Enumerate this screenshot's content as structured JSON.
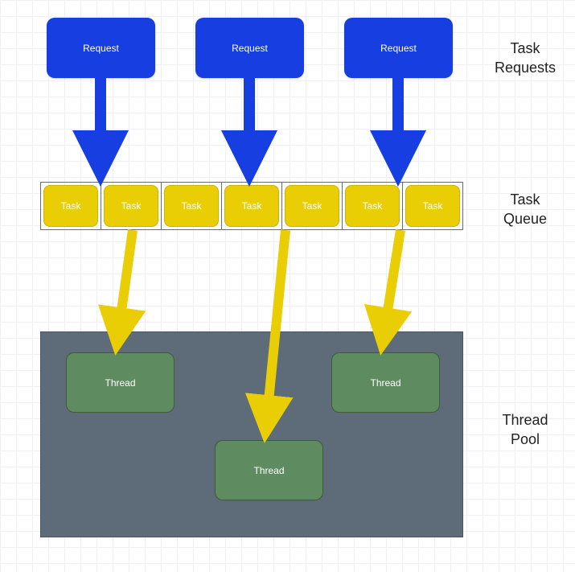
{
  "labels": {
    "requests": "Task\nRequests",
    "queue": "Task\nQueue",
    "pool": "Thread\nPool"
  },
  "requests": [
    {
      "label": "Request"
    },
    {
      "label": "Request"
    },
    {
      "label": "Request"
    }
  ],
  "queue_tasks": [
    {
      "label": "Task"
    },
    {
      "label": "Task"
    },
    {
      "label": "Task"
    },
    {
      "label": "Task"
    },
    {
      "label": "Task"
    },
    {
      "label": "Task"
    },
    {
      "label": "Task"
    }
  ],
  "threads": [
    {
      "label": "Thread"
    },
    {
      "label": "Thread"
    },
    {
      "label": "Thread"
    }
  ],
  "colors": {
    "request": "#173ee0",
    "task": "#e9ce06",
    "pool": "#5e6b78",
    "thread": "#5f8b60"
  }
}
